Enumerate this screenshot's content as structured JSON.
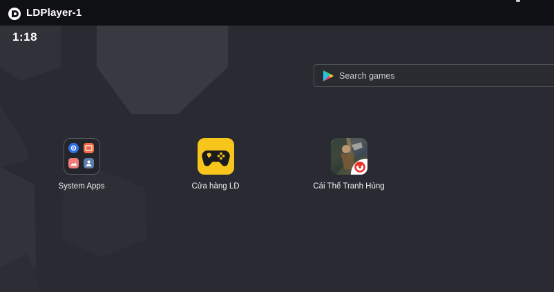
{
  "window": {
    "title": "LDPlayer-1"
  },
  "status": {
    "time": "1:18"
  },
  "search": {
    "placeholder": "Search games"
  },
  "apps": [
    {
      "label": "System Apps",
      "icon": "system-apps-folder-icon"
    },
    {
      "label": "Cửa hàng LD",
      "icon": "gamepad-icon"
    },
    {
      "label": "Cái Thế Tranh Hùng",
      "icon": "game-cover-icon"
    }
  ],
  "colors": {
    "titlebar": "#0f1013",
    "desktop": "#2a2b32",
    "ld_store_yellow": "#f7c51b",
    "garena_red": "#e8302a"
  }
}
